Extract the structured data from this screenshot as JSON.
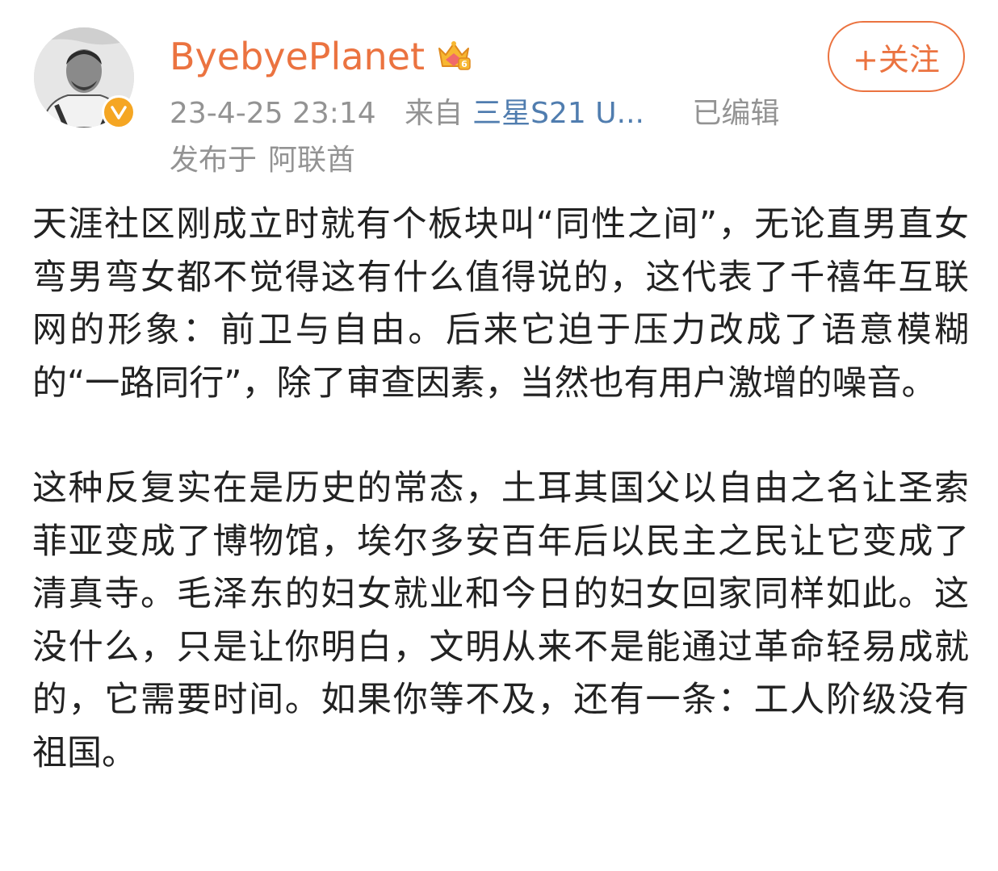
{
  "post": {
    "author": {
      "name": "ByebyePlanet",
      "avatar_icon": "person-avatar-icon",
      "verified_icon": "verified-badge-icon",
      "member_icon": "crown-member-icon"
    },
    "meta": {
      "timestamp": "23-4-25 23:14",
      "from_label": "来自",
      "source": "三星S21 U...",
      "edited": "已编辑",
      "published_label": "发布于",
      "location": "阿联酋"
    },
    "follow_button": {
      "label": "+关注"
    },
    "paragraphs": [
      "天涯社区刚成立时就有个板块叫“同性之间”，无论直男直女弯男弯女都不觉得这有什么值得说的，这代表了千禧年互联网的形象：前卫与自由。后来它迫于压力改成了语意模糊的“一路同行”，除了审查因素，当然也有用户激增的噪音。",
      "这种反复实在是历史的常态，土耳其国父以自由之名让圣索菲亚变成了博物馆，埃尔多安百年后以民主之民让它变成了清真寺。毛泽东的妇女就业和今日的妇女回家同样如此。这没什么，只是让你明白，文明从来不是能通过革命轻易成就的，它需要时间。如果你等不及，还有一条：工人阶级没有祖国。"
    ]
  },
  "colors": {
    "username": "#eb7340",
    "follow": "#eb7340",
    "meta": "#939393",
    "source_link": "#507daf",
    "verified": "#f5a623",
    "body_text": "#222222"
  }
}
